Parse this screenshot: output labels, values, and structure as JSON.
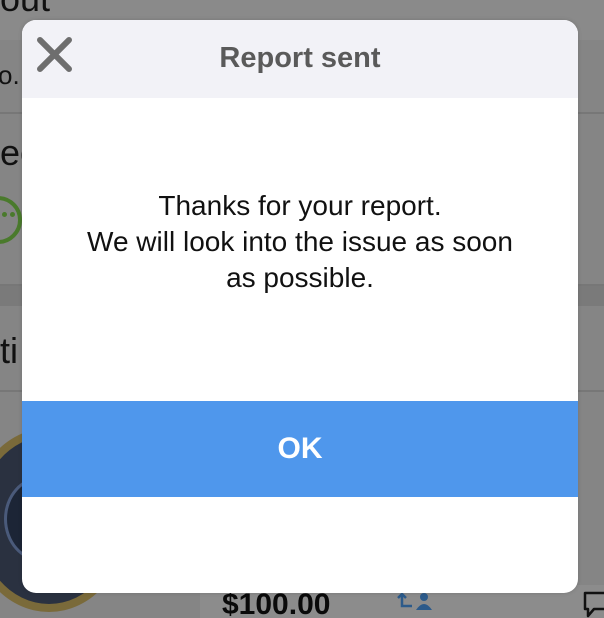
{
  "background": {
    "top_fragment": "out",
    "row1_fragment": "o.",
    "row2_fragment": "ec",
    "row3_fragment": "ti",
    "price": "$100.00",
    "icons": {
      "smiley": "smiley-icon",
      "medal": "badge-image",
      "share": "share-user-icon",
      "chat": "chat-bubble-icon"
    },
    "colors": {
      "smiley": "#4a7a2c",
      "dim_overlay": "#8a8a8a"
    }
  },
  "dialog": {
    "title": "Report sent",
    "close_icon": "close-icon",
    "message_lines": [
      "Thanks for your report.",
      "We will look into the issue as soon",
      "as possible."
    ],
    "ok_label": "OK",
    "colors": {
      "header_bg": "#f2f2f7",
      "title_text": "#5a5a5a",
      "close_icon": "#6e6e6e",
      "ok_button_bg": "#4f97ec",
      "ok_button_text": "#ffffff"
    }
  }
}
